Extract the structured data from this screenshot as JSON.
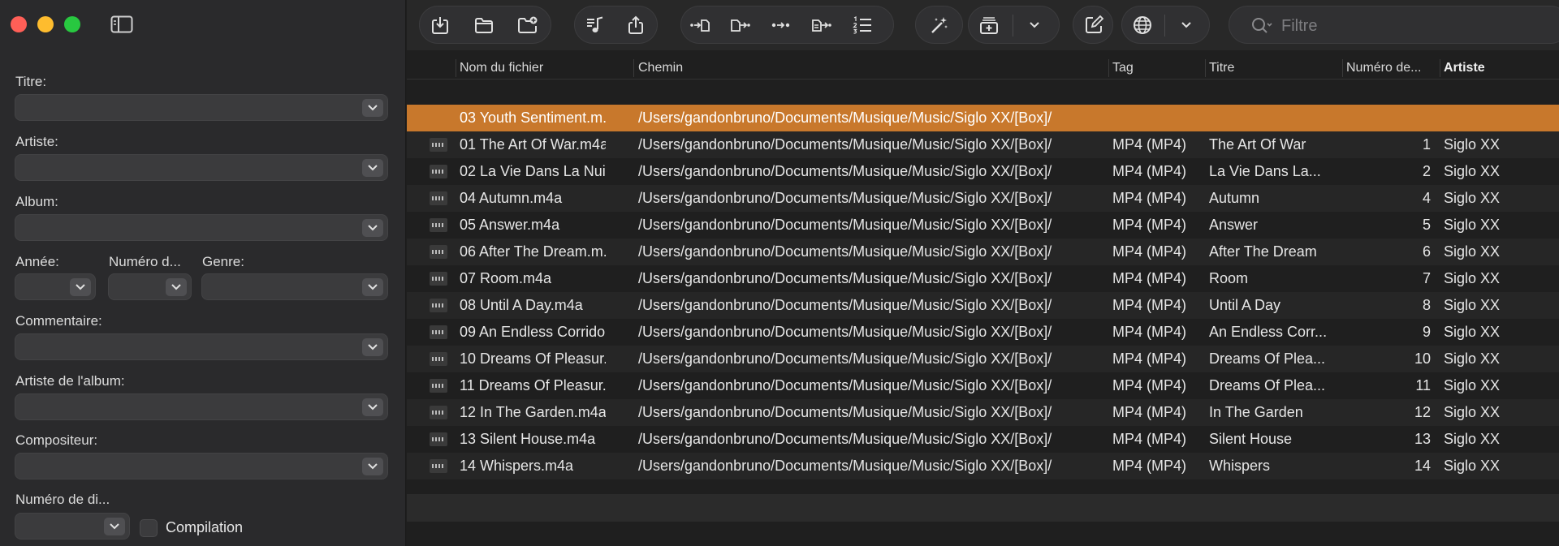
{
  "filter_placeholder": "Filtre",
  "sidebar": {
    "title_label": "Titre:",
    "artist_label": "Artiste:",
    "album_label": "Album:",
    "year_label": "Année:",
    "track_number_label": "Numéro d...",
    "genre_label": "Genre:",
    "comment_label": "Commentaire:",
    "album_artist_label": "Artiste de l'album:",
    "composer_label": "Compositeur:",
    "disc_number_label": "Numéro de di...",
    "compilation_label": "Compilation"
  },
  "toolbar": {
    "icons": [
      "import-icon",
      "open-folder-icon",
      "new-folder-icon",
      "music-note-icon",
      "share-icon",
      "tag-to-filename-icon",
      "filename-to-tag-icon",
      "tag-to-tag-icon",
      "text-to-tag-icon",
      "numbered-list-icon",
      "magic-wand-icon",
      "add-to-collection-icon",
      "chevron-down-icon",
      "edit-icon",
      "web-icon",
      "chevron-down-icon",
      "search-icon"
    ]
  },
  "table": {
    "columns": [
      "Nom du fichier",
      "Chemin",
      "Tag",
      "Titre",
      "Numéro de...",
      "Artiste"
    ],
    "rows": [
      {
        "filename": "03 Youth Sentiment.m...",
        "path": "/Users/gandonbruno/Documents/Musique/Music/Siglo XX/[Box]/",
        "tag": "",
        "title": "",
        "number": "",
        "artist": ""
      },
      {
        "filename": "01 The Art Of War.m4a",
        "path": "/Users/gandonbruno/Documents/Musique/Music/Siglo XX/[Box]/",
        "tag": "MP4 (MP4)",
        "title": "The Art Of War",
        "number": "1",
        "artist": "Siglo XX"
      },
      {
        "filename": "02 La Vie Dans La Nui...",
        "path": "/Users/gandonbruno/Documents/Musique/Music/Siglo XX/[Box]/",
        "tag": "MP4 (MP4)",
        "title": "La Vie Dans La...",
        "number": "2",
        "artist": "Siglo XX"
      },
      {
        "filename": "04 Autumn.m4a",
        "path": "/Users/gandonbruno/Documents/Musique/Music/Siglo XX/[Box]/",
        "tag": "MP4 (MP4)",
        "title": "Autumn",
        "number": "4",
        "artist": "Siglo XX"
      },
      {
        "filename": "05 Answer.m4a",
        "path": "/Users/gandonbruno/Documents/Musique/Music/Siglo XX/[Box]/",
        "tag": "MP4 (MP4)",
        "title": "Answer",
        "number": "5",
        "artist": "Siglo XX"
      },
      {
        "filename": "06 After The Dream.m...",
        "path": "/Users/gandonbruno/Documents/Musique/Music/Siglo XX/[Box]/",
        "tag": "MP4 (MP4)",
        "title": "After The Dream",
        "number": "6",
        "artist": "Siglo XX"
      },
      {
        "filename": "07 Room.m4a",
        "path": "/Users/gandonbruno/Documents/Musique/Music/Siglo XX/[Box]/",
        "tag": "MP4 (MP4)",
        "title": "Room",
        "number": "7",
        "artist": "Siglo XX"
      },
      {
        "filename": "08 Until A Day.m4a",
        "path": "/Users/gandonbruno/Documents/Musique/Music/Siglo XX/[Box]/",
        "tag": "MP4 (MP4)",
        "title": "Until A Day",
        "number": "8",
        "artist": "Siglo XX"
      },
      {
        "filename": "09 An Endless Corrido...",
        "path": "/Users/gandonbruno/Documents/Musique/Music/Siglo XX/[Box]/",
        "tag": "MP4 (MP4)",
        "title": "An Endless Corr...",
        "number": "9",
        "artist": "Siglo XX"
      },
      {
        "filename": "10 Dreams Of Pleasur...",
        "path": "/Users/gandonbruno/Documents/Musique/Music/Siglo XX/[Box]/",
        "tag": "MP4 (MP4)",
        "title": "Dreams Of Plea...",
        "number": "10",
        "artist": "Siglo XX"
      },
      {
        "filename": "11 Dreams Of Pleasur...",
        "path": "/Users/gandonbruno/Documents/Musique/Music/Siglo XX/[Box]/",
        "tag": "MP4 (MP4)",
        "title": "Dreams Of Plea...",
        "number": "11",
        "artist": "Siglo XX"
      },
      {
        "filename": "12 In The Garden.m4a",
        "path": "/Users/gandonbruno/Documents/Musique/Music/Siglo XX/[Box]/",
        "tag": "MP4 (MP4)",
        "title": "In The Garden",
        "number": "12",
        "artist": "Siglo XX"
      },
      {
        "filename": "13 Silent House.m4a",
        "path": "/Users/gandonbruno/Documents/Musique/Music/Siglo XX/[Box]/",
        "tag": "MP4 (MP4)",
        "title": "Silent House",
        "number": "13",
        "artist": "Siglo XX"
      },
      {
        "filename": "14 Whispers.m4a",
        "path": "/Users/gandonbruno/Documents/Musique/Music/Siglo XX/[Box]/",
        "tag": "MP4 (MP4)",
        "title": "Whispers",
        "number": "14",
        "artist": "Siglo XX"
      }
    ]
  },
  "colors": {
    "selection": "#c8782c",
    "window_bg": "#1e1e1e",
    "sidebar_bg": "#2a2a2c"
  }
}
